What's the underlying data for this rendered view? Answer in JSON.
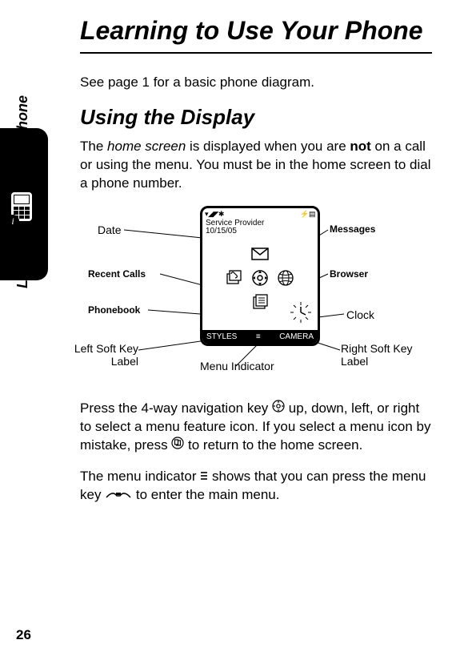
{
  "page_number": "26",
  "side_label": "Learning to Use Your Phone",
  "title": "Learning to Use Your Phone",
  "lead": "See page 1 for a basic phone diagram.",
  "section": "Using the Display",
  "para1_a": "The ",
  "para1_b": "home screen",
  "para1_c": " is displayed when you are ",
  "para1_d": "not",
  "para1_e": " on a call or using the menu. You must be in the home screen to dial a phone number.",
  "diagram": {
    "status_left": "▾◢◤✱",
    "status_right": "⚡▤",
    "provider": "Service Provider",
    "date_value": "10/15/05",
    "soft_left": "STYLES",
    "soft_right": "CAMERA",
    "menu_indicator": "≡"
  },
  "labels": {
    "date": "Date",
    "recent": "Recent Calls",
    "phonebook": "Phonebook",
    "left_soft_1": "Left Soft Key",
    "left_soft_2": "Label",
    "messages": "Messages",
    "browser": "Browser",
    "clock": "Clock",
    "right_soft_1": "Right Soft Key",
    "right_soft_2": "Label",
    "menu_ind": "Menu Indicator"
  },
  "para2_a": "Press the 4-way navigation key ",
  "para2_b": " up, down, left, or right to select a menu feature icon. If you select a menu icon by mistake, press ",
  "para2_c": " to return to the home screen.",
  "para3_a": "The menu indicator ",
  "para3_b": " shows that you can press the menu key ",
  "para3_c": " to enter the main menu."
}
